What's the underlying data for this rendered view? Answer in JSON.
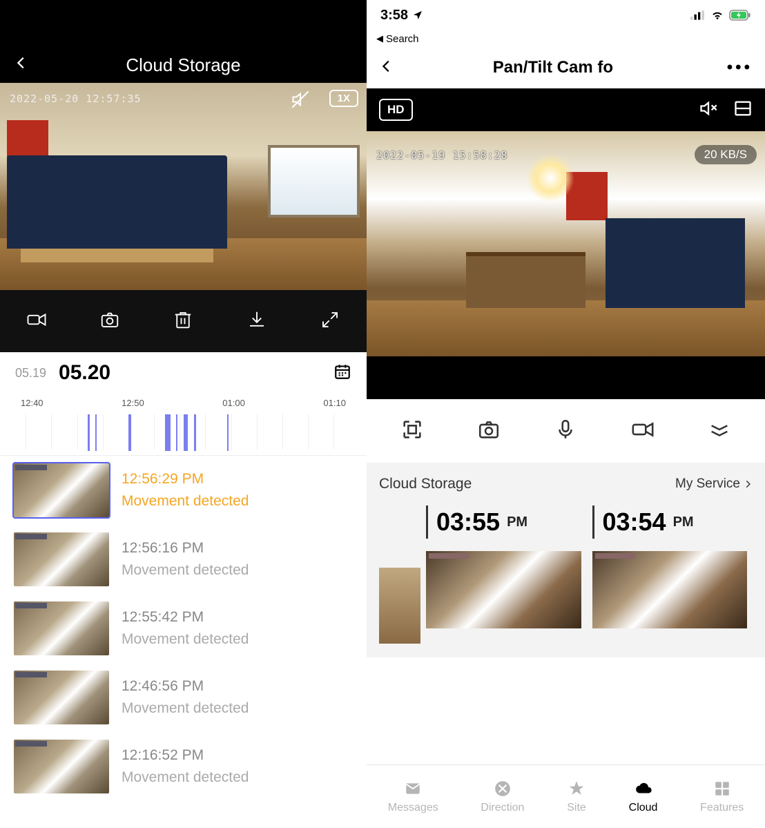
{
  "left": {
    "header_title": "Cloud Storage",
    "video_timestamp": "2022-05-20 12:57:35",
    "speed_label": "1X",
    "date_inactive": "05.19",
    "date_active": "05.20",
    "timeline_labels": [
      "12:40",
      "12:50",
      "01:00",
      "01:10"
    ],
    "events": [
      {
        "time": "12:56:29 PM",
        "desc": "Movement detected",
        "selected": true
      },
      {
        "time": "12:56:16 PM",
        "desc": "Movement detected",
        "selected": false
      },
      {
        "time": "12:55:42 PM",
        "desc": "Movement detected",
        "selected": false
      },
      {
        "time": "12:46:56 PM",
        "desc": "Movement detected",
        "selected": false
      },
      {
        "time": "12:16:52 PM",
        "desc": "Movement detected",
        "selected": false
      }
    ]
  },
  "right": {
    "status_time": "3:58",
    "search_return": "Search",
    "header_title": "Pan/Tilt Cam fo",
    "hd_label": "HD",
    "video_timestamp": "2022-05-19 15:58:28",
    "data_rate": "20 KB/S",
    "cloud_label": "Cloud Storage",
    "my_service": "My Service",
    "clips": [
      {
        "time": "03:55",
        "ampm": "PM"
      },
      {
        "time": "03:54",
        "ampm": "PM"
      }
    ],
    "tabs": [
      {
        "label": "Messages"
      },
      {
        "label": "Direction"
      },
      {
        "label": "Site"
      },
      {
        "label": "Cloud",
        "active": true
      },
      {
        "label": "Features"
      }
    ]
  }
}
